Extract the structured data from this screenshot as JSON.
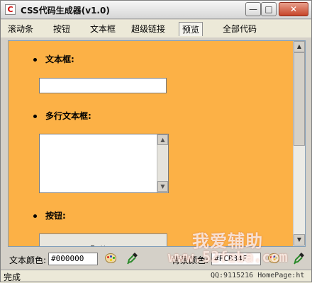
{
  "window": {
    "title": "CSS代码生成器(v1.0)",
    "controls": {
      "minimize": "—",
      "maximize": "□",
      "close": "✕"
    }
  },
  "tabs": [
    {
      "label": "滚动条"
    },
    {
      "label": "按钮"
    },
    {
      "label": "文本框"
    },
    {
      "label": "超级链接"
    },
    {
      "label": "预览",
      "active": true
    },
    {
      "label": "全部代码"
    }
  ],
  "preview": {
    "background_color": "#FCB146",
    "items": [
      {
        "label": "文本框:"
      },
      {
        "label": "多行文本框:"
      },
      {
        "label": "按钮:"
      }
    ],
    "text_box_value": "",
    "textarea_value": "",
    "button_label": "Button"
  },
  "controls": {
    "text_color_label": "文本颜色:",
    "text_color_value": "#000000",
    "bg_color_label": "背景颜色:",
    "bg_color_value": "#FCB34F"
  },
  "statusbar": {
    "text": "完成",
    "right_text": "QQ:9115216 HomePage:ht"
  },
  "watermark": {
    "title": "我爱辅助",
    "url": "www.52fzba.com"
  },
  "icons": {
    "app": "css-app-icon",
    "palette": "palette-icon",
    "dropper": "eyedropper-icon"
  }
}
